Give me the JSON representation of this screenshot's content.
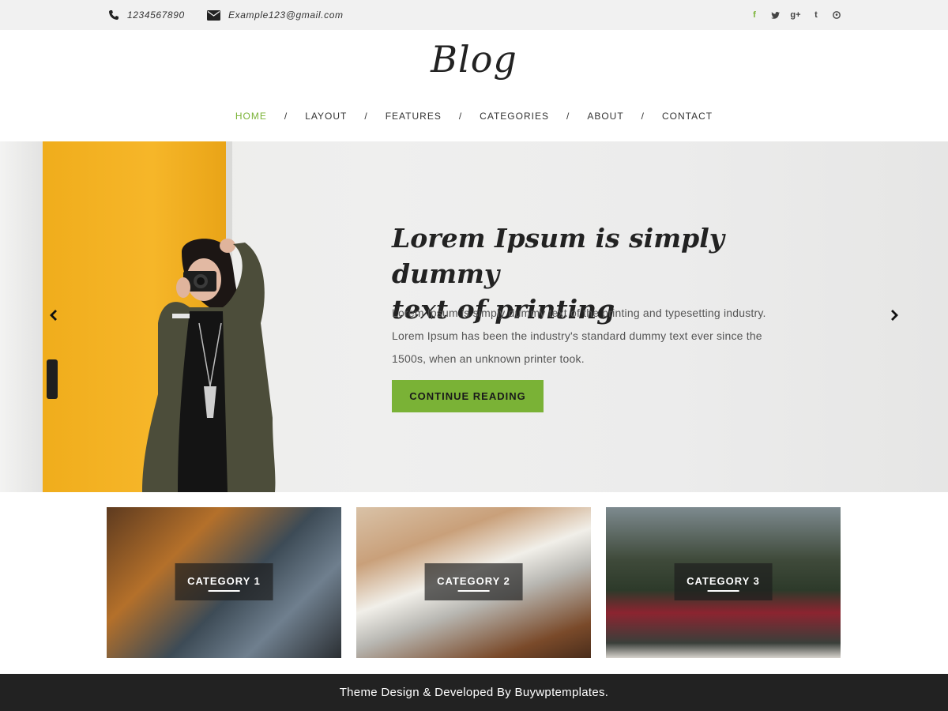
{
  "topbar": {
    "phone": "1234567890",
    "email": "Example123@gmail.com",
    "socials": [
      {
        "icon": "facebook-icon",
        "glyph": "f"
      },
      {
        "icon": "twitter-icon",
        "glyph": "t"
      },
      {
        "icon": "google-plus-icon",
        "glyph": "g+"
      },
      {
        "icon": "tumblr-icon",
        "glyph": "t"
      },
      {
        "icon": "pinterest-icon",
        "glyph": "p"
      }
    ]
  },
  "header": {
    "logo": "Blog"
  },
  "nav": {
    "items": [
      "HOME",
      "LAYOUT",
      "FEATURES",
      "CATEGORIES",
      "ABOUT",
      "CONTACT"
    ],
    "separator": "/",
    "active_index": 0
  },
  "hero": {
    "title_line1": "Lorem Ipsum is simply dummy",
    "title_line2": "text of printing",
    "text_line1": "Lorem Ipsum is simply dummy text of the printing and typesetting industry.",
    "text_line2": "Lorem Ipsum has been the industry's standard dummy text ever since the",
    "text_line3": "1500s, when an unknown printer took.",
    "button": "CONTINUE READING"
  },
  "categories": [
    "CATEGORY 1",
    "CATEGORY 2",
    "CATEGORY 3"
  ],
  "footer": {
    "text": "Theme Design & Developed By Buywptemplates."
  },
  "colors": {
    "accent": "#7ab236",
    "topbar_bg": "#f1f1f1",
    "footer_bg": "#222222"
  }
}
